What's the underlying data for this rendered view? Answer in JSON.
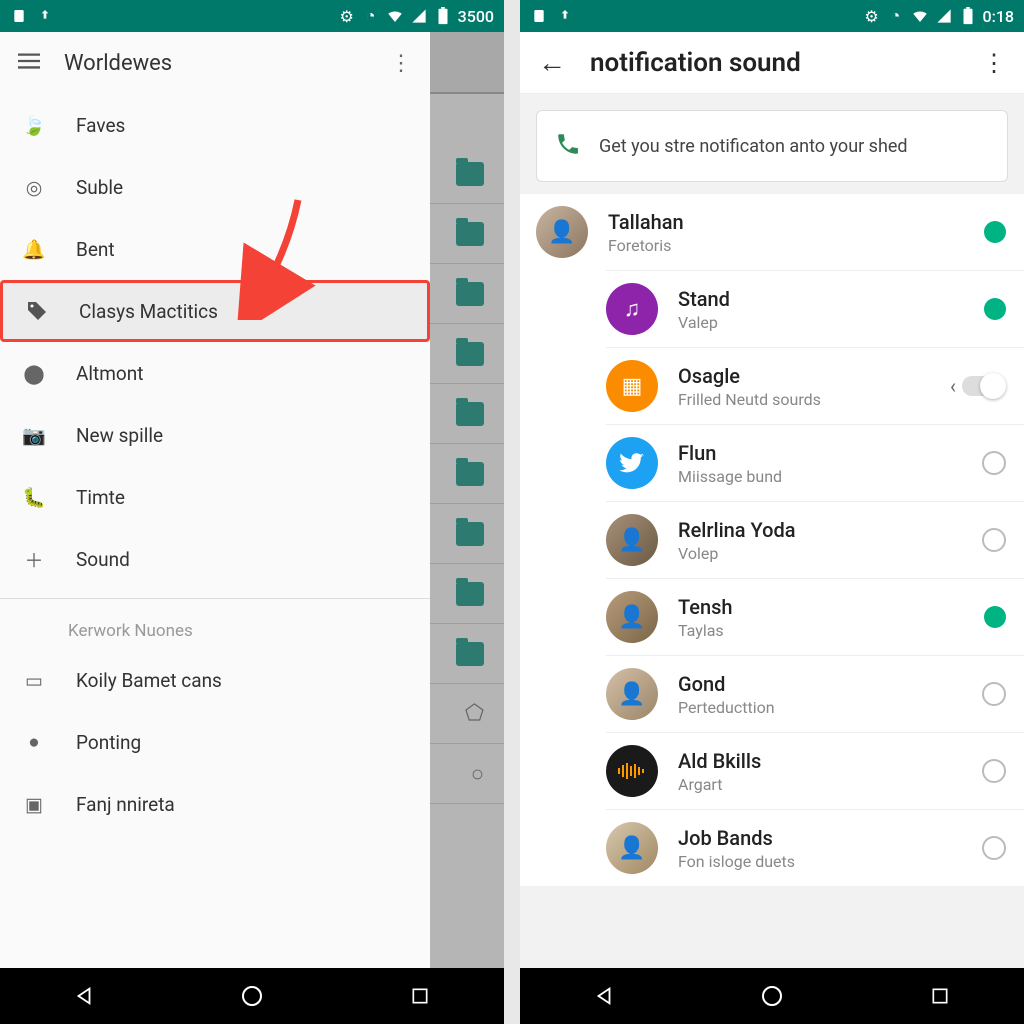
{
  "left": {
    "status_time": "3500",
    "drawer_title": "Worldewes",
    "nav_items": [
      {
        "label": "Faves",
        "icon": "leaf"
      },
      {
        "label": "Suble",
        "icon": "target"
      },
      {
        "label": "Bent",
        "icon": "bell"
      },
      {
        "label": "Clasys Mactitics",
        "icon": "tag",
        "highlighted": true
      },
      {
        "label": "Altmont",
        "icon": "circle"
      },
      {
        "label": "New spille",
        "icon": "camera"
      },
      {
        "label": "Timte",
        "icon": "bug"
      },
      {
        "label": "Sound",
        "icon": "plus"
      }
    ],
    "section_header": "Kerwork Nuones",
    "nav_items2": [
      {
        "label": "Koily Bamet cans",
        "icon": "card"
      },
      {
        "label": "Ponting",
        "icon": "dot"
      },
      {
        "label": "Fanj nnireta",
        "icon": "chip"
      }
    ]
  },
  "right": {
    "status_time": "0:18",
    "page_title": "notification sound",
    "info_text": "Get you stre notificaton anto your shed",
    "items": [
      {
        "title": "Tallahan",
        "sub": "Foretoris",
        "avatar": "photo",
        "state": "on"
      },
      {
        "title": "Stand",
        "sub": "Valep",
        "avatar": "purple",
        "state": "on"
      },
      {
        "title": "Osagle",
        "sub": "Frilled Neutd sourds",
        "avatar": "orange",
        "state": "switch"
      },
      {
        "title": "Flun",
        "sub": "Miissage bund",
        "avatar": "twitter",
        "state": "off"
      },
      {
        "title": "Relrlina Yoda",
        "sub": "Volep",
        "avatar": "photo2",
        "state": "off"
      },
      {
        "title": "Tensh",
        "sub": "Taylas",
        "avatar": "photo3",
        "state": "on"
      },
      {
        "title": "Gond",
        "sub": "Perteducttion",
        "avatar": "photo4",
        "state": "off"
      },
      {
        "title": "Ald Bkills",
        "sub": "Argart",
        "avatar": "black",
        "state": "off"
      },
      {
        "title": "Job Bands",
        "sub": "Fon isloge duets",
        "avatar": "photo5",
        "state": "off"
      }
    ]
  }
}
